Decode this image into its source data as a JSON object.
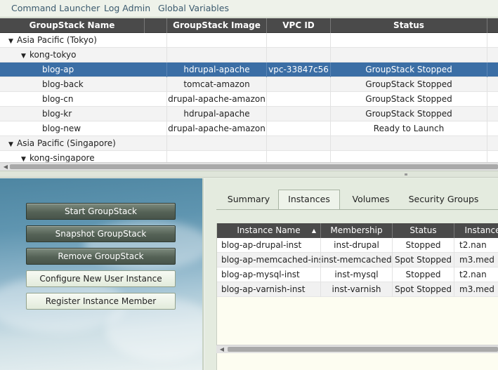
{
  "menu": [
    "Command Launcher",
    "Log Admin",
    "Global Variables"
  ],
  "groupgrid": {
    "columns": [
      "GroupStack Name",
      "GroupStack Image",
      "VPC ID",
      "Status"
    ],
    "rows": [
      {
        "name": "Asia Pacific (Tokyo)",
        "image": "",
        "vpc": "",
        "status": "",
        "level": 0,
        "expanded": true
      },
      {
        "name": "kong-tokyo",
        "image": "",
        "vpc": "",
        "status": "",
        "level": 1,
        "expanded": true
      },
      {
        "name": "blog-ap",
        "image": "hdrupal-apache",
        "vpc": "vpc-33847c56",
        "status": "GroupStack Stopped",
        "level": 2,
        "selected": true
      },
      {
        "name": "blog-back",
        "image": "tomcat-amazon",
        "vpc": "",
        "status": "GroupStack Stopped",
        "level": 2
      },
      {
        "name": "blog-cn",
        "image": "drupal-apache-amazon",
        "vpc": "",
        "status": "GroupStack Stopped",
        "level": 2
      },
      {
        "name": "blog-kr",
        "image": "hdrupal-apache",
        "vpc": "",
        "status": "GroupStack Stopped",
        "level": 2
      },
      {
        "name": "blog-new",
        "image": "drupal-apache-amazon",
        "vpc": "",
        "status": "Ready to Launch",
        "level": 2
      },
      {
        "name": "Asia Pacific (Singapore)",
        "image": "",
        "vpc": "",
        "status": "",
        "level": 0,
        "expanded": true
      },
      {
        "name": "kong-singapore",
        "image": "",
        "vpc": "",
        "status": "",
        "level": 1,
        "expanded": true
      }
    ]
  },
  "actions": {
    "start": "Start GroupStack",
    "snapshot": "Snapshot GroupStack",
    "remove": "Remove GroupStack",
    "configure": "Configure New User Instance",
    "register": "Register Instance Member"
  },
  "tabs": {
    "summary": "Summary",
    "instances": "Instances",
    "volumes": "Volumes",
    "security": "Security Groups",
    "active": "Instances"
  },
  "instancegrid": {
    "columns": [
      "Instance Name",
      "Membership",
      "Status",
      "Instance"
    ],
    "sort_arrow": "▲",
    "rows": [
      {
        "name": "blog-ap-drupal-inst",
        "membership": "inst-drupal",
        "status": "Stopped",
        "type": "t2.nan"
      },
      {
        "name": "blog-ap-memcached-inst",
        "membership": "inst-memcached",
        "status": "Spot Stopped",
        "type": "m3.med"
      },
      {
        "name": "blog-ap-mysql-inst",
        "membership": "inst-mysql",
        "status": "Stopped",
        "type": "t2.nan"
      },
      {
        "name": "blog-ap-varnish-inst",
        "membership": "inst-varnish",
        "status": "Spot Stopped",
        "type": "m3.med"
      }
    ]
  },
  "scroll": {
    "left_arrow": "◀"
  }
}
